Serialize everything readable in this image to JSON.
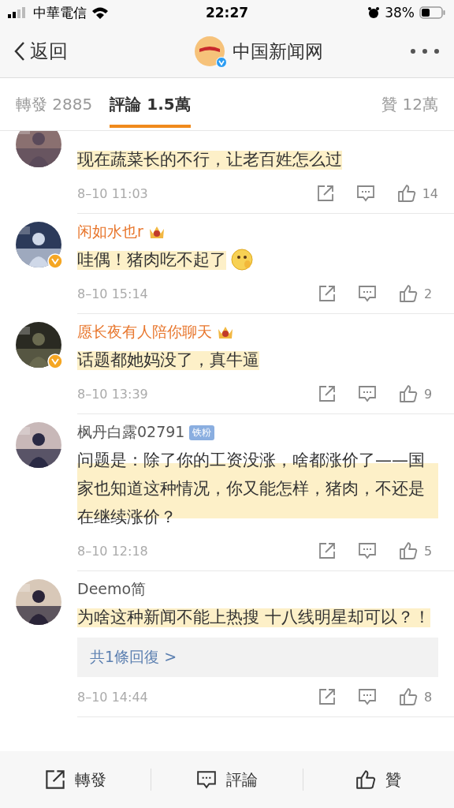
{
  "status_bar": {
    "carrier": "中華電信",
    "time": "22:27",
    "battery": "38%"
  },
  "nav": {
    "back": "返回",
    "title": "中国新闻网",
    "verified": true
  },
  "tabs": [
    {
      "label": "轉發 2885",
      "selected": false
    },
    {
      "label": "評論 1.5萬",
      "selected": true
    },
    {
      "label": "贊 12萬",
      "selected": false
    }
  ],
  "comments": [
    {
      "text": "现在蔬菜长的不行，让老百姓怎么过",
      "time": "8–10 11:03",
      "likes": "14"
    },
    {
      "name": "闲如水也r",
      "text": "哇偶！猪肉吃不起了",
      "time": "8–10 15:14",
      "likes": "2",
      "vip": true,
      "verified": true,
      "emoji": true
    },
    {
      "name": "愿长夜有人陪你聊天",
      "text": "话题都她妈没了，真牛逼",
      "time": "8–10 13:39",
      "likes": "9",
      "vip": true,
      "verified": true
    },
    {
      "name": "枫丹白露02791",
      "fan_badge": "铁粉",
      "text": "问题是：除了你的工资没涨，啥都涨价了——国家也知道这种情况，你又能怎样，猪肉，不还是在继续涨价？",
      "time": "8–10 12:18",
      "likes": "5"
    },
    {
      "name": "Deemo简",
      "text": "为啥这种新闻不能上热搜 十八线明星却可以？！",
      "reply": "共1條回復 >",
      "time": "8–10 14:44",
      "likes": "8"
    }
  ],
  "bottom_bar": [
    "轉發",
    "評論",
    "贊"
  ]
}
